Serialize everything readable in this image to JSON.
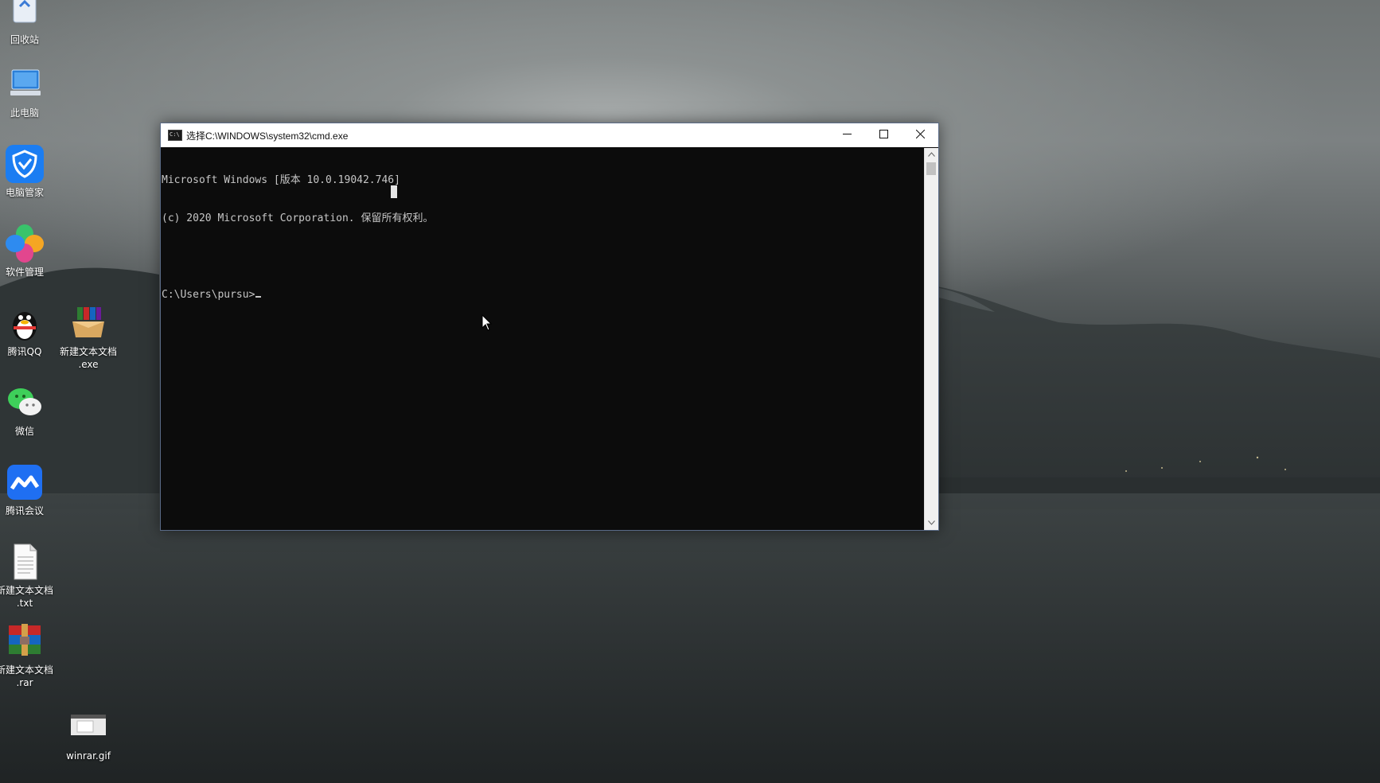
{
  "desktop": {
    "icons": [
      {
        "id": "recycle-bin",
        "label": "回收站",
        "icon": "recycle-bin-icon"
      },
      {
        "id": "this-pc",
        "label": "此电脑",
        "icon": "computer-icon"
      },
      {
        "id": "pc-manager",
        "label": "电脑管家",
        "icon": "shield-icon"
      },
      {
        "id": "software-manager",
        "label": "软件管理",
        "icon": "clover-icon"
      },
      {
        "id": "tencent-qq",
        "label": "腾讯QQ",
        "icon": "penguin-icon"
      },
      {
        "id": "new-text-exe",
        "label": "新建文本文档\n.exe",
        "icon": "package-icon"
      },
      {
        "id": "wechat",
        "label": "微信",
        "icon": "chat-bubbles-icon"
      },
      {
        "id": "tencent-meeting",
        "label": "腾讯会议",
        "icon": "meeting-icon"
      },
      {
        "id": "new-text-txt",
        "label": "新建文本文档\n.txt",
        "icon": "text-file-icon"
      },
      {
        "id": "new-text-rar",
        "label": "新建文本文档\n.rar",
        "icon": "winrar-icon"
      },
      {
        "id": "winrar-gif",
        "label": "winrar.gif",
        "icon": "image-file-icon"
      }
    ]
  },
  "cmd": {
    "title": "选择C:\\WINDOWS\\system32\\cmd.exe",
    "lines": [
      "Microsoft Windows [版本 10.0.19042.746]",
      "(c) 2020 Microsoft Corporation. 保留所有权利。",
      "",
      "C:\\Users\\pursu>"
    ],
    "buttons": {
      "minimize": "—",
      "maximize": "☐",
      "close": "✕"
    },
    "scroll": {
      "up": "▲",
      "down": "▼"
    }
  },
  "colors": {
    "console_bg": "#0c0c0c",
    "console_text": "#c6c6c6",
    "titlebar_bg": "#ffffff"
  }
}
